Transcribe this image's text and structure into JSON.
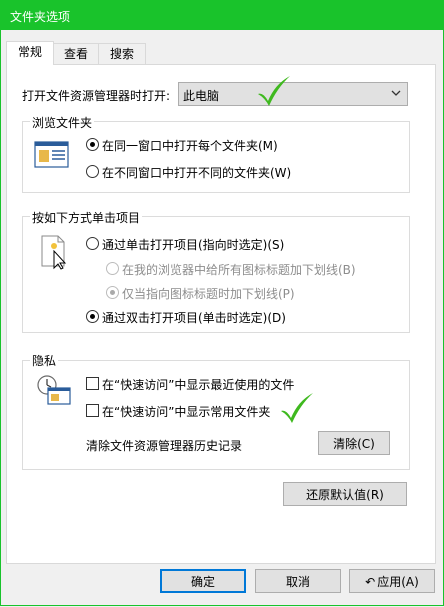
{
  "window": {
    "title": "文件夹选项"
  },
  "tabs": [
    {
      "label": "常规",
      "active": true
    },
    {
      "label": "查看",
      "active": false
    },
    {
      "label": "搜索",
      "active": false
    }
  ],
  "general": {
    "open_in_label": "打开文件资源管理器时打开:",
    "open_in_value": "此电脑",
    "browse": {
      "title": "浏览文件夹",
      "options": [
        {
          "label": "在同一窗口中打开每个文件夹(M)",
          "checked": true
        },
        {
          "label": "在不同窗口中打开不同的文件夹(W)",
          "checked": false
        }
      ]
    },
    "click": {
      "title": "按如下方式单击项目",
      "single": {
        "label": "通过单击打开项目(指向时选定)(S)",
        "checked": false
      },
      "underline_all": {
        "label": "在我的浏览器中给所有图标标题加下划线(B)",
        "checked": false,
        "disabled": true
      },
      "underline_hover": {
        "label": "仅当指向图标标题时加下划线(P)",
        "checked": true,
        "disabled": true
      },
      "double": {
        "label": "通过双击打开项目(单击时选定)(D)",
        "checked": true
      }
    },
    "privacy": {
      "title": "隐私",
      "show_recent": {
        "label": "在“快速访问”中显示最近使用的文件",
        "checked": false
      },
      "show_frequent": {
        "label": "在“快速访问”中显示常用文件夹",
        "checked": false
      },
      "clear_label": "清除文件资源管理器历史记录",
      "clear_button": "清除(C)"
    },
    "restore_defaults": "还原默认值(R)"
  },
  "footer": {
    "ok": "确定",
    "cancel": "取消",
    "apply": "应用(A)"
  },
  "colors": {
    "titlebar": "#19c32b",
    "checkmark": "#3fb91f",
    "focus": "#0078d7"
  }
}
